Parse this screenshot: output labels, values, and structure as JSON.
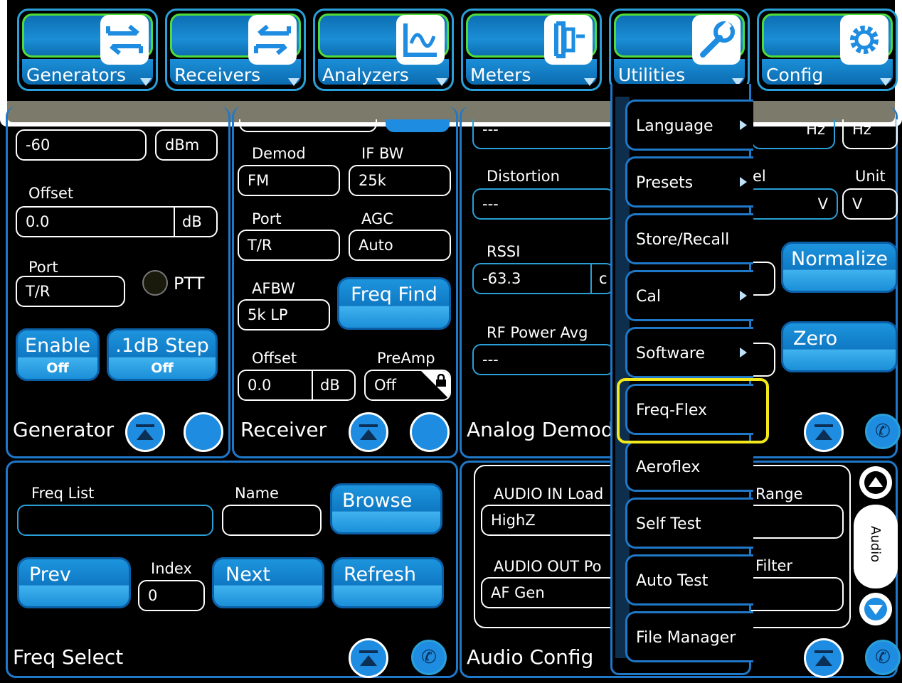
{
  "nav": {
    "tabs": [
      {
        "label": "Generators",
        "icon": "generator-arrows-icon"
      },
      {
        "label": "Receivers",
        "icon": "receiver-arrows-icon"
      },
      {
        "label": "Analyzers",
        "icon": "waveform-icon"
      },
      {
        "label": "Meters",
        "icon": "meter-icon"
      },
      {
        "label": "Utilities",
        "icon": "wrench-icon"
      },
      {
        "label": "Config",
        "icon": "gear-icon"
      }
    ]
  },
  "generator": {
    "level_value": "-60",
    "level_unit": "dBm",
    "offset_label": "Offset",
    "offset_value": "0.0",
    "offset_unit": "dB",
    "port_label": "Port",
    "port_value": "T/R",
    "ptt_label": "PTT",
    "enable_label": "Enable",
    "enable_state": "Off",
    "step_label": ".1dB Step",
    "step_state": "Off",
    "title": "Generator"
  },
  "receiver": {
    "demod_label": "Demod",
    "demod_value": "FM",
    "ifbw_label": "IF BW",
    "ifbw_value": "25k",
    "port_label": "Port",
    "port_value": "T/R",
    "agc_label": "AGC",
    "agc_value": "Auto",
    "afbw_label": "AFBW",
    "afbw_value": "5k LP",
    "freqfind_label": "Freq Find",
    "offset_label": "Offset",
    "offset_value": "0.0",
    "offset_unit": "dB",
    "preamp_label": "PreAmp",
    "preamp_value": "Off",
    "title": "Receiver"
  },
  "analog_demod": {
    "top_value": "---",
    "distortion_label": "Distortion",
    "distortion_value": "---",
    "rssi_label": "RSSI",
    "rssi_value": "-63.3",
    "rssi_unit_partial": "c",
    "rfpower_label": "RF Power Avg",
    "rfpower_value": "---",
    "title": "Analog Demod",
    "hz1": "Hz",
    "hz2": "Hz",
    "level_partial": "el",
    "unit_label": "Unit",
    "v1": "V",
    "v2": "V",
    "normalize_label": "Normalize",
    "zero_label": "Zero"
  },
  "freq_select": {
    "freqlist_label": "Freq List",
    "name_label": "Name",
    "browse_label": "Browse",
    "prev_label": "Prev",
    "index_label": "Index",
    "index_value": "0",
    "next_label": "Next",
    "refresh_label": "Refresh",
    "title": "Freq Select"
  },
  "audio_config": {
    "audio_in_label": "AUDIO IN Load",
    "audio_in_value": "HighZ",
    "audio_out_label": "AUDIO OUT Po",
    "audio_out_value": "AF Gen",
    "range_label": "Range",
    "filter_label": "Filter",
    "side_tab": "Audio",
    "title": "Audio Config"
  },
  "utilities_menu": {
    "items": [
      {
        "label": "Language",
        "submenu": true
      },
      {
        "label": "Presets",
        "submenu": true
      },
      {
        "label": "Store/Recall",
        "submenu": false
      },
      {
        "label": "Cal",
        "submenu": true
      },
      {
        "label": "Software",
        "submenu": true
      },
      {
        "label": "Freq-Flex",
        "submenu": false
      },
      {
        "label": "Aeroflex",
        "submenu": false
      },
      {
        "label": "Self Test",
        "submenu": false
      },
      {
        "label": "Auto Test",
        "submenu": false
      },
      {
        "label": "File Manager",
        "submenu": false
      }
    ],
    "highlighted": "Freq-Flex",
    "highlight_color": "#f2e81c"
  },
  "colors": {
    "accent": "#1e8ce0",
    "panel_border": "#1f78c8",
    "active_green": "#4fdc3a"
  }
}
